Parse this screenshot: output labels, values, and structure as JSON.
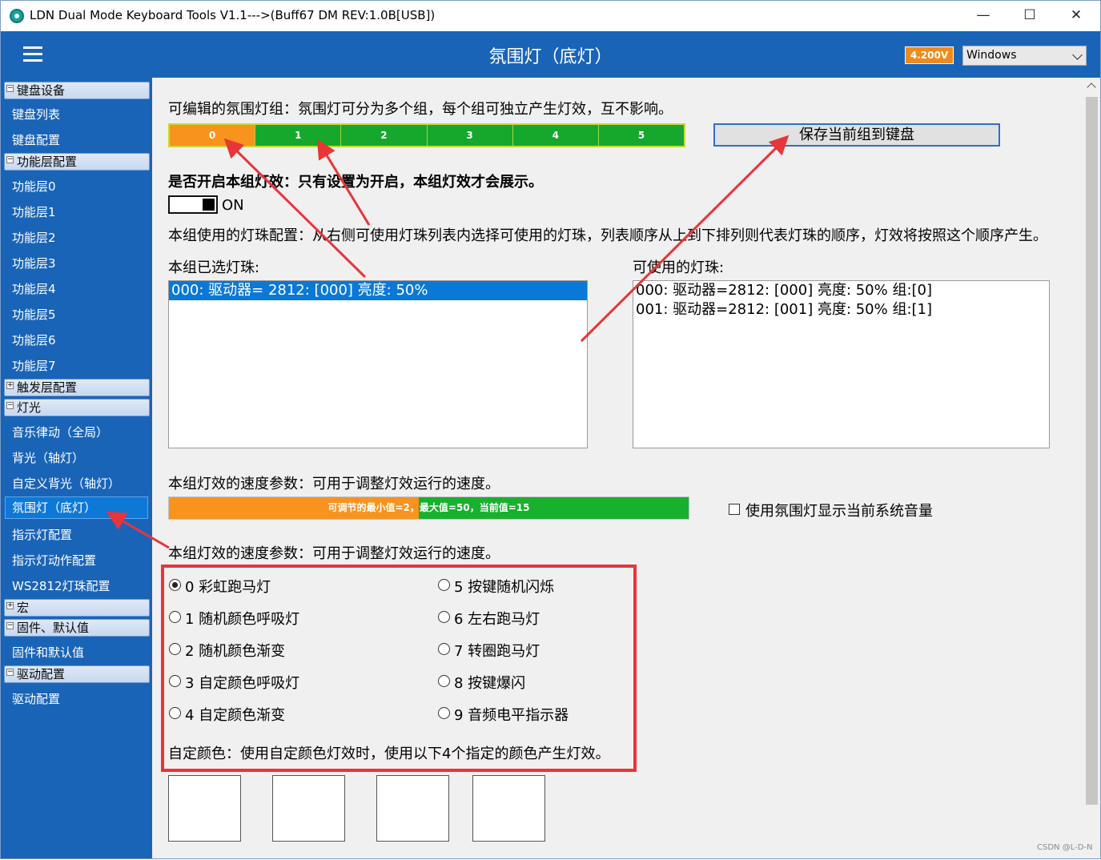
{
  "window": {
    "title": "LDN Dual Mode Keyboard Tools V1.1--->(Buff67 DM REV:1.0B[USB])",
    "minimize": "—",
    "maximize": "☐",
    "close": "✕"
  },
  "header": {
    "title": "氛围灯（底灯）",
    "voltage": "4.200V",
    "os_selected": "Windows"
  },
  "sidebar": {
    "groups": {
      "keyboard": "键盘设备",
      "layers": "功能层配置",
      "trigger": "触发层配置",
      "lighting": "灯光",
      "macro": "宏",
      "firmware": "固件、默认值",
      "driver": "驱动配置"
    },
    "items": {
      "kb_list": "键盘列表",
      "kb_config": "键盘配置",
      "layer0": "功能层0",
      "layer1": "功能层1",
      "layer2": "功能层2",
      "layer3": "功能层3",
      "layer4": "功能层4",
      "layer5": "功能层5",
      "layer6": "功能层6",
      "layer7": "功能层7",
      "music": "音乐律动（全局）",
      "backlight": "背光（轴灯）",
      "custom_backlight": "自定义背光（轴灯）",
      "ambient": "氛围灯（底灯）",
      "indicator": "指示灯配置",
      "indicator_action": "指示灯动作配置",
      "ws2812": "WS2812灯珠配置",
      "firmware_defaults": "固件和默认值",
      "driver_config": "驱动配置"
    },
    "expanded_sign": "−",
    "collapsed_sign": "+"
  },
  "main": {
    "groups_desc": "可编辑的氛围灯组：氛围灯可分为多个组，每个组可独立产生灯效，互不影响。",
    "groups": [
      "0",
      "1",
      "2",
      "3",
      "4",
      "5"
    ],
    "selected_group": "0",
    "save_button": "保存当前组到键盘",
    "enable_desc": "是否开启本组灯效：只有设置为开启，本组灯效才会展示。",
    "toggle_state": "ON",
    "led_config_desc": "本组使用的灯珠配置：从右侧可使用灯珠列表内选择可使用的灯珠，列表顺序从上到下排列则代表灯珠的顺序，灯效将按照这个顺序产生。",
    "selected_leds_label": "本组已选灯珠:",
    "selected_leds": [
      "000: 驱动器= 2812: [000] 亮度:  50%"
    ],
    "available_leds_label": "可使用的灯珠:",
    "available_leds": [
      "000: 驱动器=2812: [000] 亮度:  50% 组:[0]",
      "001: 驱动器=2812: [001] 亮度:  50% 组:[1]"
    ],
    "speed_desc": "本组灯效的速度参数：可用于调整灯效运行的速度。",
    "speed_min": 2,
    "speed_max": 50,
    "speed_value": 15,
    "speed_label": "可调节的最小值=2，最大值=50，当前值=15",
    "volume_checkbox_label": "使用氛围灯显示当前系统音量",
    "volume_checked": false,
    "effect_desc": "本组灯效的速度参数：可用于调整灯效运行的速度。",
    "effects": [
      "0 彩虹跑马灯",
      "1 随机颜色呼吸灯",
      "2 随机颜色渐变",
      "3 自定颜色呼吸灯",
      "4 自定颜色渐变",
      "5 按键随机闪烁",
      "6 左右跑马灯",
      "7 转圈跑马灯",
      "8 按键爆闪",
      "9 音频电平指示器"
    ],
    "selected_effect": "0 彩虹跑马灯",
    "custom_color_desc": "自定颜色：使用自定颜色灯效时，使用以下4个指定的颜色产生灯效。",
    "custom_colors": [
      "#ffffff",
      "#ffffff",
      "#ffffff",
      "#ffffff"
    ]
  },
  "colors": {
    "accent_blue": "#1a64b8",
    "selected_orange": "#f8931e",
    "group_green": "#16a82c",
    "highlight_red": "#e8353a"
  },
  "watermark": "CSDN @L-D-N"
}
